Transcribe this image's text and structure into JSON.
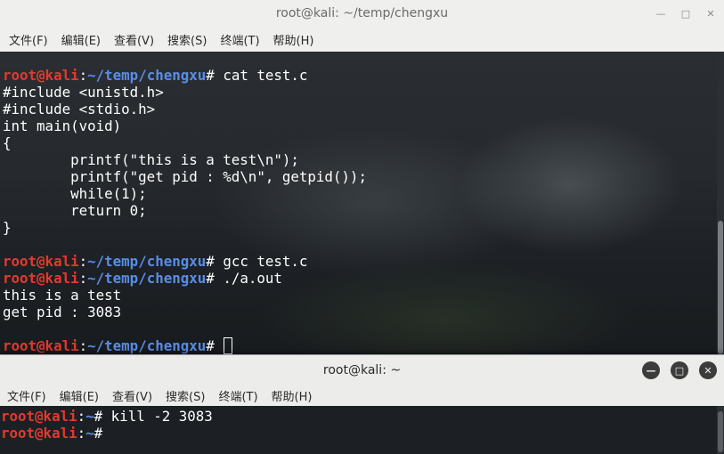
{
  "window_top": {
    "title": "root@kali: ~/temp/chengxu",
    "controls": {
      "minimize": "—",
      "maximize": "□",
      "close": "✕"
    },
    "menu": [
      "文件(F)",
      "编辑(E)",
      "查看(V)",
      "搜索(S)",
      "终端(T)",
      "帮助(H)"
    ],
    "terminal": {
      "prompt_user": "root@kali",
      "prompt_colon": ":",
      "prompt_path": "~/temp/chengxu",
      "prompt_symbol": "# ",
      "cmd1": "cat test.c",
      "source_lines": [
        "#include <unistd.h>",
        "#include <stdio.h>",
        "int main(void)",
        "{",
        "        printf(\"this is a test\\n\");",
        "        printf(\"get pid : %d\\n\", getpid());",
        "        while(1);",
        "        return 0;",
        "}"
      ],
      "cmd2": "gcc test.c",
      "cmd3": "./a.out",
      "output_lines": [
        "this is a test",
        "get pid : 3083"
      ]
    }
  },
  "window_bottom": {
    "title": "root@kali: ~",
    "controls": {
      "minimize": "—",
      "maximize": "□",
      "close": "✕"
    },
    "menu": [
      "文件(F)",
      "编辑(E)",
      "查看(V)",
      "搜索(S)",
      "终端(T)",
      "帮助(H)"
    ],
    "terminal": {
      "prompt_user": "root@kali",
      "prompt_colon": ":",
      "prompt_path": "~",
      "prompt_symbol": "# ",
      "cmd1": "kill -2 3083"
    }
  }
}
